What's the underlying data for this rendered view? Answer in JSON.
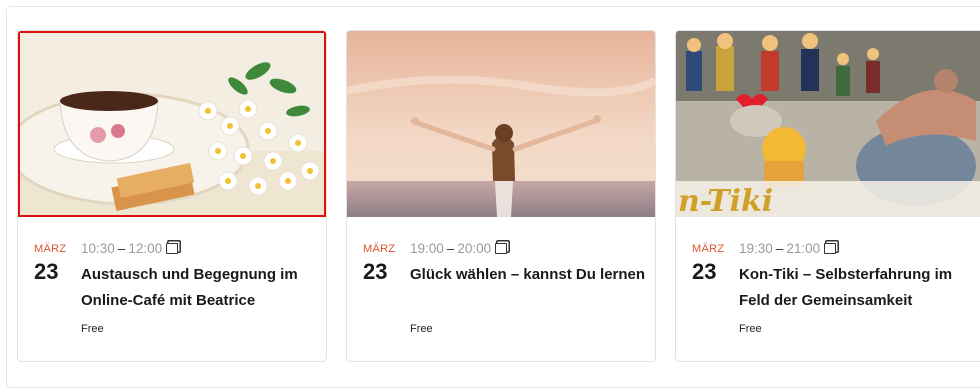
{
  "events": [
    {
      "month": "MÄRZ",
      "day": "23",
      "time_start": "10:30",
      "time_end": "12:00",
      "title": "Austausch und Begegnung im Online-Café mit Beatrice",
      "price": "Free",
      "image": "coffee-cup-with-daisies"
    },
    {
      "month": "MÄRZ",
      "day": "23",
      "time_start": "19:00",
      "time_end": "20:00",
      "title": "Glück wählen – kannst Du lernen",
      "price": "Free",
      "image": "woman-arms-raised-at-sea"
    },
    {
      "month": "MÄRZ",
      "day": "23",
      "time_start": "19:30",
      "time_end": "21:00",
      "title": "Kon-Tiki – Selbsterfahrung im Feld der Gemeinsamkeit",
      "price": "Free",
      "image": "figurines-kon-tiki",
      "image_text": "n-Tiki"
    }
  ],
  "colors": {
    "month_accent": "#e0542f",
    "selection_outline": "#e01010"
  }
}
